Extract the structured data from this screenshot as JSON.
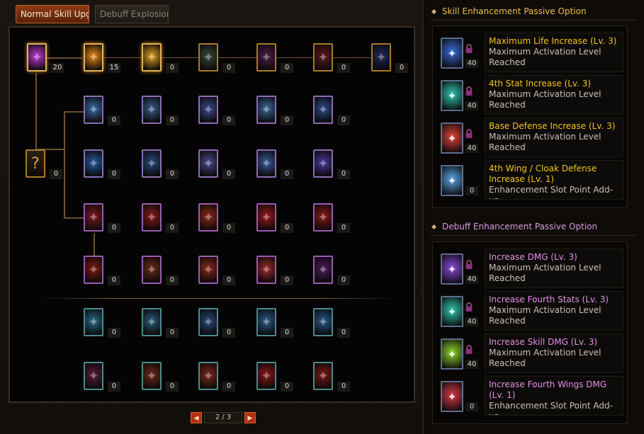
{
  "tabs": [
    {
      "label": "Normal Skill Upgi",
      "active": true
    },
    {
      "label": "Debuff Explosion",
      "active": false
    }
  ],
  "tree": {
    "rows": [
      {
        "levels": [
          "20",
          "15",
          "0",
          "0",
          "0",
          "0",
          "0"
        ]
      },
      {
        "levels": [
          "0",
          "0",
          "0",
          "0",
          "0"
        ]
      },
      {
        "levels": [
          "0",
          "0",
          "0",
          "0",
          "0"
        ]
      },
      {
        "levels": [
          "0",
          "0",
          "0",
          "0",
          "0"
        ]
      },
      {
        "levels": [
          "0",
          "0",
          "0",
          "0",
          "0"
        ]
      },
      {
        "levels": [
          "0",
          "0",
          "0",
          "0",
          "0"
        ]
      },
      {
        "levels": [
          "0",
          "0",
          "0",
          "0",
          "0"
        ]
      }
    ],
    "mystery_node_level": "0",
    "mystery_glyph": "?"
  },
  "pager": {
    "prev": "◀",
    "page": "2 / 3",
    "next": "▶"
  },
  "skill_section": {
    "title": "Skill Enhancement Passive Option",
    "options": [
      {
        "title": "Maximum Life Increase (Lv. 3)",
        "desc": "Maximum Activation Level Reached",
        "level": "40",
        "locked": true,
        "icon": "life-icon",
        "color": "#3a6fd8"
      },
      {
        "title": "4th Stat Increase (Lv. 3)",
        "desc": "Maximum Activation Level Reached",
        "level": "40",
        "locked": true,
        "icon": "stat-icon",
        "color": "#2fc7b0"
      },
      {
        "title": "Base Defense Increase (Lv. 3)",
        "desc": "Maximum Activation Level Reached",
        "level": "40",
        "locked": true,
        "icon": "defense-icon",
        "color": "#e0453d"
      },
      {
        "title": "4th Wing / Cloak Defense Increase (Lv. 1)",
        "desc": "Enhancement Slot Point Add-up",
        "level": "0",
        "locked": false,
        "icon": "wing-icon",
        "color": "#5aa7e8"
      }
    ]
  },
  "debuff_section": {
    "title": "Debuff Enhancement Passive Option",
    "options": [
      {
        "title": "Increase DMG (Lv. 3)",
        "desc": "Maximum Activation Level Reached",
        "level": "40",
        "locked": true,
        "icon": "sword-icon",
        "color": "#8a4bd8"
      },
      {
        "title": "Increase Fourth Stats (Lv. 3)",
        "desc": "Maximum Activation Level Reached",
        "level": "40",
        "locked": true,
        "icon": "stat-icon",
        "color": "#2fc7b0"
      },
      {
        "title": "Increase Skill DMG (Lv. 3)",
        "desc": "Maximum Activation Level Reached",
        "level": "40",
        "locked": true,
        "icon": "skill-dmg-icon",
        "color": "#8fd82f"
      },
      {
        "title": "Increase Fourth Wings DMG (Lv. 1)",
        "desc": "Enhancement Slot Point Add-up",
        "level": "0",
        "locked": false,
        "icon": "wing-icon",
        "color": "#d83a4a"
      }
    ]
  }
}
